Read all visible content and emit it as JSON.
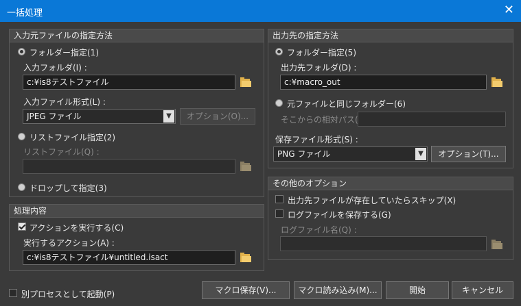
{
  "window": {
    "title": "一括処理",
    "close_glyph": "✕"
  },
  "input_group": {
    "title": "入力元ファイルの指定方法",
    "folder_radio": "フォルダー指定(1)",
    "input_folder_label": "入力フォルダ(I) :",
    "input_folder_value": "c:¥is8テストファイル",
    "input_format_label": "入力ファイル形式(L) :",
    "input_format_value": "JPEG ファイル",
    "options_button": "オプション(O)...",
    "list_radio": "リストファイル指定(2)",
    "list_file_label": "リストファイル(Q) :",
    "list_file_value": "",
    "drop_radio": "ドロップして指定(3)"
  },
  "process_group": {
    "title": "処理内容",
    "action_check": "アクションを実行する(C)",
    "action_label": "実行するアクション(A) :",
    "action_value": "c:¥is8テストファイル¥untitled.isact"
  },
  "output_group": {
    "title": "出力先の指定方法",
    "folder_radio": "フォルダー指定(5)",
    "output_folder_label": "出力先フォルダ(D) :",
    "output_folder_value": "c:¥macro_out",
    "same_folder_radio": "元ファイルと同じフォルダー(6)",
    "relative_path_label": "そこからの相対パス(B) :",
    "relative_path_value": "",
    "save_format_label": "保存ファイル形式(S) :",
    "save_format_value": "PNG ファイル",
    "options_button": "オプション(T)..."
  },
  "other_group": {
    "title": "その他のオプション",
    "skip_check": "出力先ファイルが存在していたらスキップ(X)",
    "log_check": "ログファイルを保存する(G)",
    "log_name_label": "ログファイル名(Q) :",
    "log_name_value": ""
  },
  "footer": {
    "separate_process_check": "別プロセスとして起動(P)",
    "save_macro": "マクロ保存(V)...",
    "load_macro": "マクロ読み込み(M)...",
    "start": "開始",
    "cancel": "キャンセル"
  },
  "icons": {
    "folder_color": "#e1b14b",
    "titlebar_color": "#0a78d7"
  }
}
